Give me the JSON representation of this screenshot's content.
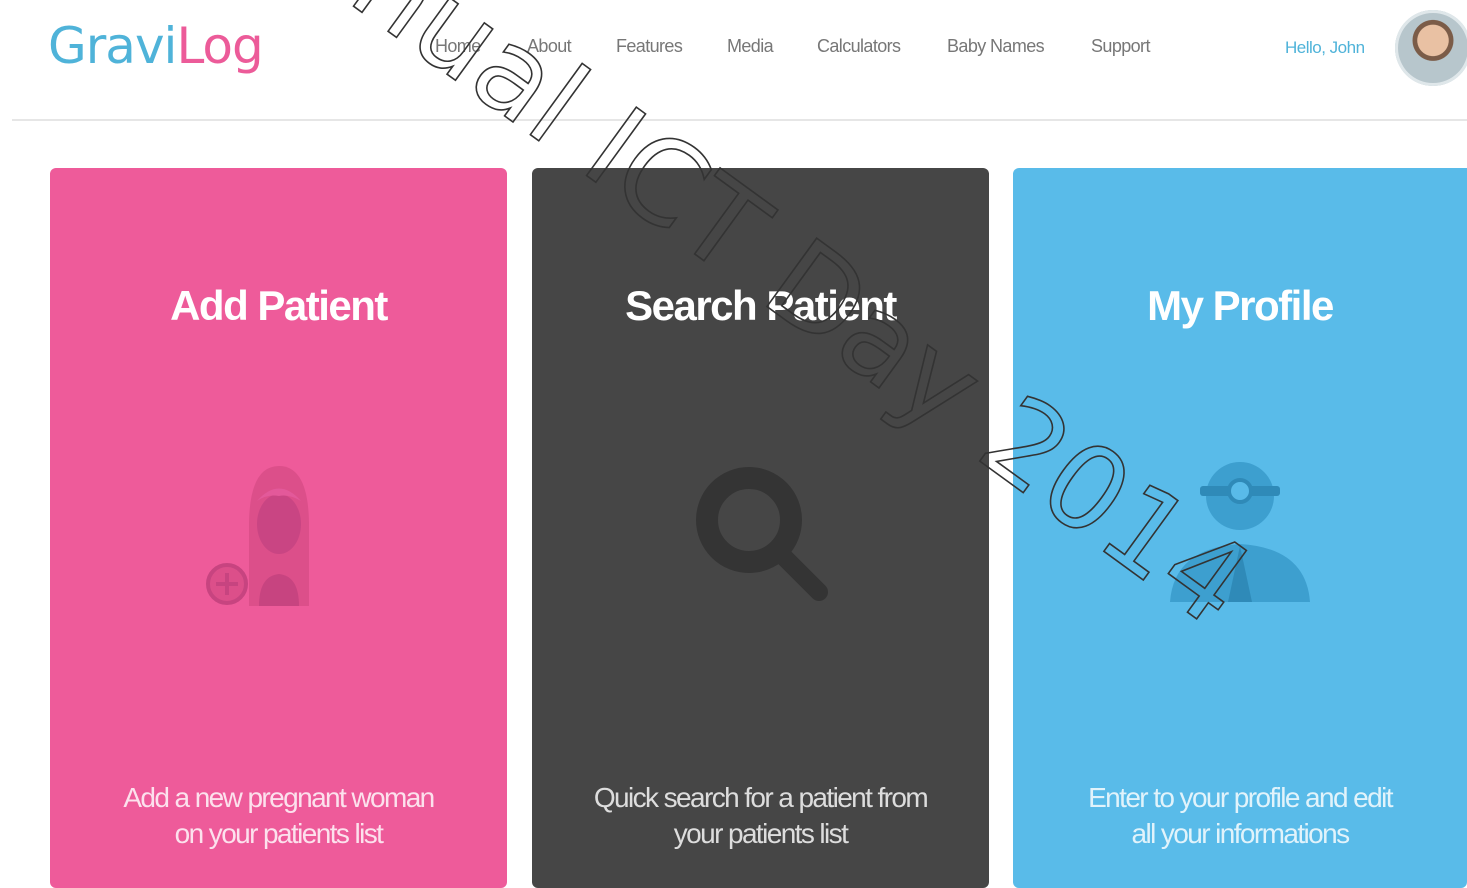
{
  "header": {
    "logo_part1": "Gravi",
    "logo_part2": "Log",
    "nav": [
      "Home",
      "About",
      "Features",
      "Media",
      "Calculators",
      "Baby Names",
      "Support"
    ],
    "greeting": "Hello, John"
  },
  "cards": [
    {
      "title": "Add Patient",
      "desc_line1": "Add a new pregnant woman",
      "desc_line2": "on your patients list",
      "icon": "woman-add-icon",
      "color": "#ee5b9a"
    },
    {
      "title": "Search Patient",
      "desc_line1": "Quick search for a patient from",
      "desc_line2": "your patients list",
      "icon": "magnifier-icon",
      "color": "#464646"
    },
    {
      "title": "My Profile",
      "desc_line1": "Enter to your profile and edit",
      "desc_line2": "all your informations",
      "icon": "doctor-icon",
      "color": "#59bbe9"
    }
  ],
  "watermark": "nual ICT Day 2014",
  "colors": {
    "accent_blue": "#4fb3d9",
    "accent_pink": "#ec5b99"
  }
}
